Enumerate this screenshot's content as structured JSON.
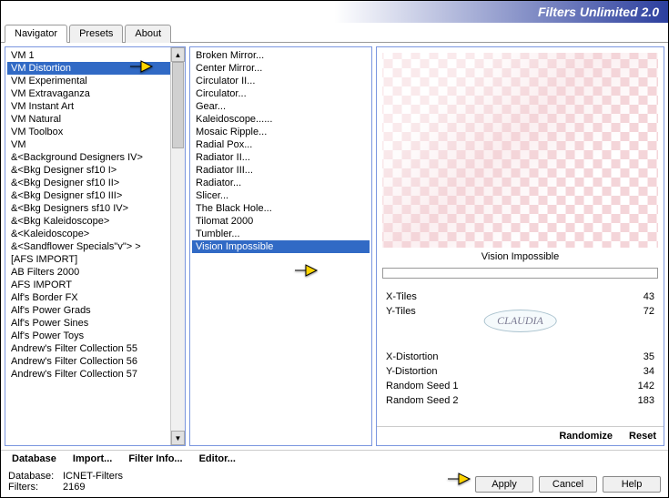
{
  "title": "Filters Unlimited 2.0",
  "tabs": [
    "Navigator",
    "Presets",
    "About"
  ],
  "categories": [
    "VM 1",
    "VM Distortion",
    "VM Experimental",
    "VM Extravaganza",
    "VM Instant Art",
    "VM Natural",
    "VM Toolbox",
    "VM",
    "&<Background Designers IV>",
    "&<Bkg Designer sf10 I>",
    "&<Bkg Designer sf10 II>",
    "&<Bkg Designer sf10 III>",
    "&<Bkg Designers sf10 IV>",
    "&<Bkg Kaleidoscope>",
    "&<Kaleidoscope>",
    "&<Sandflower Specials\"v\"> >",
    "[AFS IMPORT]",
    "AB Filters 2000",
    "AFS IMPORT",
    "Alf's Border FX",
    "Alf's Power Grads",
    "Alf's Power Sines",
    "Alf's Power Toys",
    "Andrew's Filter Collection 55",
    "Andrew's Filter Collection 56",
    "Andrew's Filter Collection 57"
  ],
  "selected_category_index": 1,
  "filters": [
    "Broken Mirror...",
    "Center Mirror...",
    "Circulator II...",
    "Circulator...",
    "Gear...",
    "Kaleidoscope......",
    "Mosaic Ripple...",
    "Radial Pox...",
    "Radiator II...",
    "Radiator III...",
    "Radiator...",
    "Slicer...",
    "The Black Hole...",
    "Tilomat 2000",
    "Tumbler...",
    "Vision Impossible"
  ],
  "selected_filter_index": 15,
  "preview_label": "Vision Impossible",
  "params": [
    {
      "name": "X-Tiles",
      "value": 43
    },
    {
      "name": "Y-Tiles",
      "value": 72
    },
    {
      "name": "X-Distortion",
      "value": 35
    },
    {
      "name": "Y-Distortion",
      "value": 34
    },
    {
      "name": "Random Seed 1",
      "value": 142
    },
    {
      "name": "Random Seed 2",
      "value": 183
    }
  ],
  "watermark": "CLAUDIA",
  "footer": {
    "left": [
      "Database",
      "Import...",
      "Filter Info...",
      "Editor..."
    ],
    "right": [
      "Randomize",
      "Reset"
    ]
  },
  "status": {
    "db_label": "Database:",
    "db_value": "ICNET-Filters",
    "filters_label": "Filters:",
    "filters_value": "2169"
  },
  "buttons": {
    "apply": "Apply",
    "cancel": "Cancel",
    "help": "Help"
  }
}
